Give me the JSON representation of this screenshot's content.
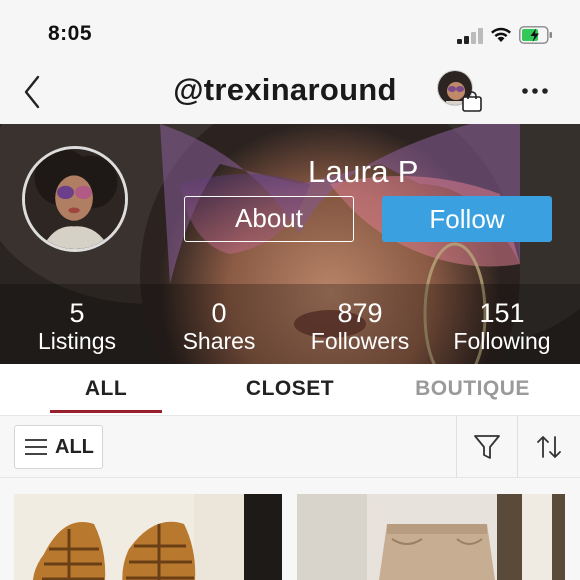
{
  "status_bar": {
    "time": "8:05"
  },
  "nav": {
    "title": "@trexinaround"
  },
  "profile": {
    "name": "Laura P",
    "about_label": "About",
    "follow_label": "Follow",
    "stats": [
      {
        "value": "5",
        "label": "Listings"
      },
      {
        "value": "0",
        "label": "Shares"
      },
      {
        "value": "879",
        "label": "Followers"
      },
      {
        "value": "151",
        "label": "Following"
      }
    ]
  },
  "tabs": [
    {
      "label": "ALL",
      "active": true
    },
    {
      "label": "CLOSET",
      "active": false
    },
    {
      "label": "BOUTIQUE",
      "active": false
    }
  ],
  "filter": {
    "all_label": "ALL"
  },
  "colors": {
    "accent_red": "#9a1f2d",
    "follow_blue": "#3aa0e0",
    "battery_green": "#34c759"
  },
  "icons": [
    "back-chevron-icon",
    "shopping-bag-icon",
    "more-icon",
    "hamburger-icon",
    "filter-funnel-icon",
    "sort-arrows-icon",
    "signal-icon",
    "wifi-icon",
    "battery-icon"
  ]
}
